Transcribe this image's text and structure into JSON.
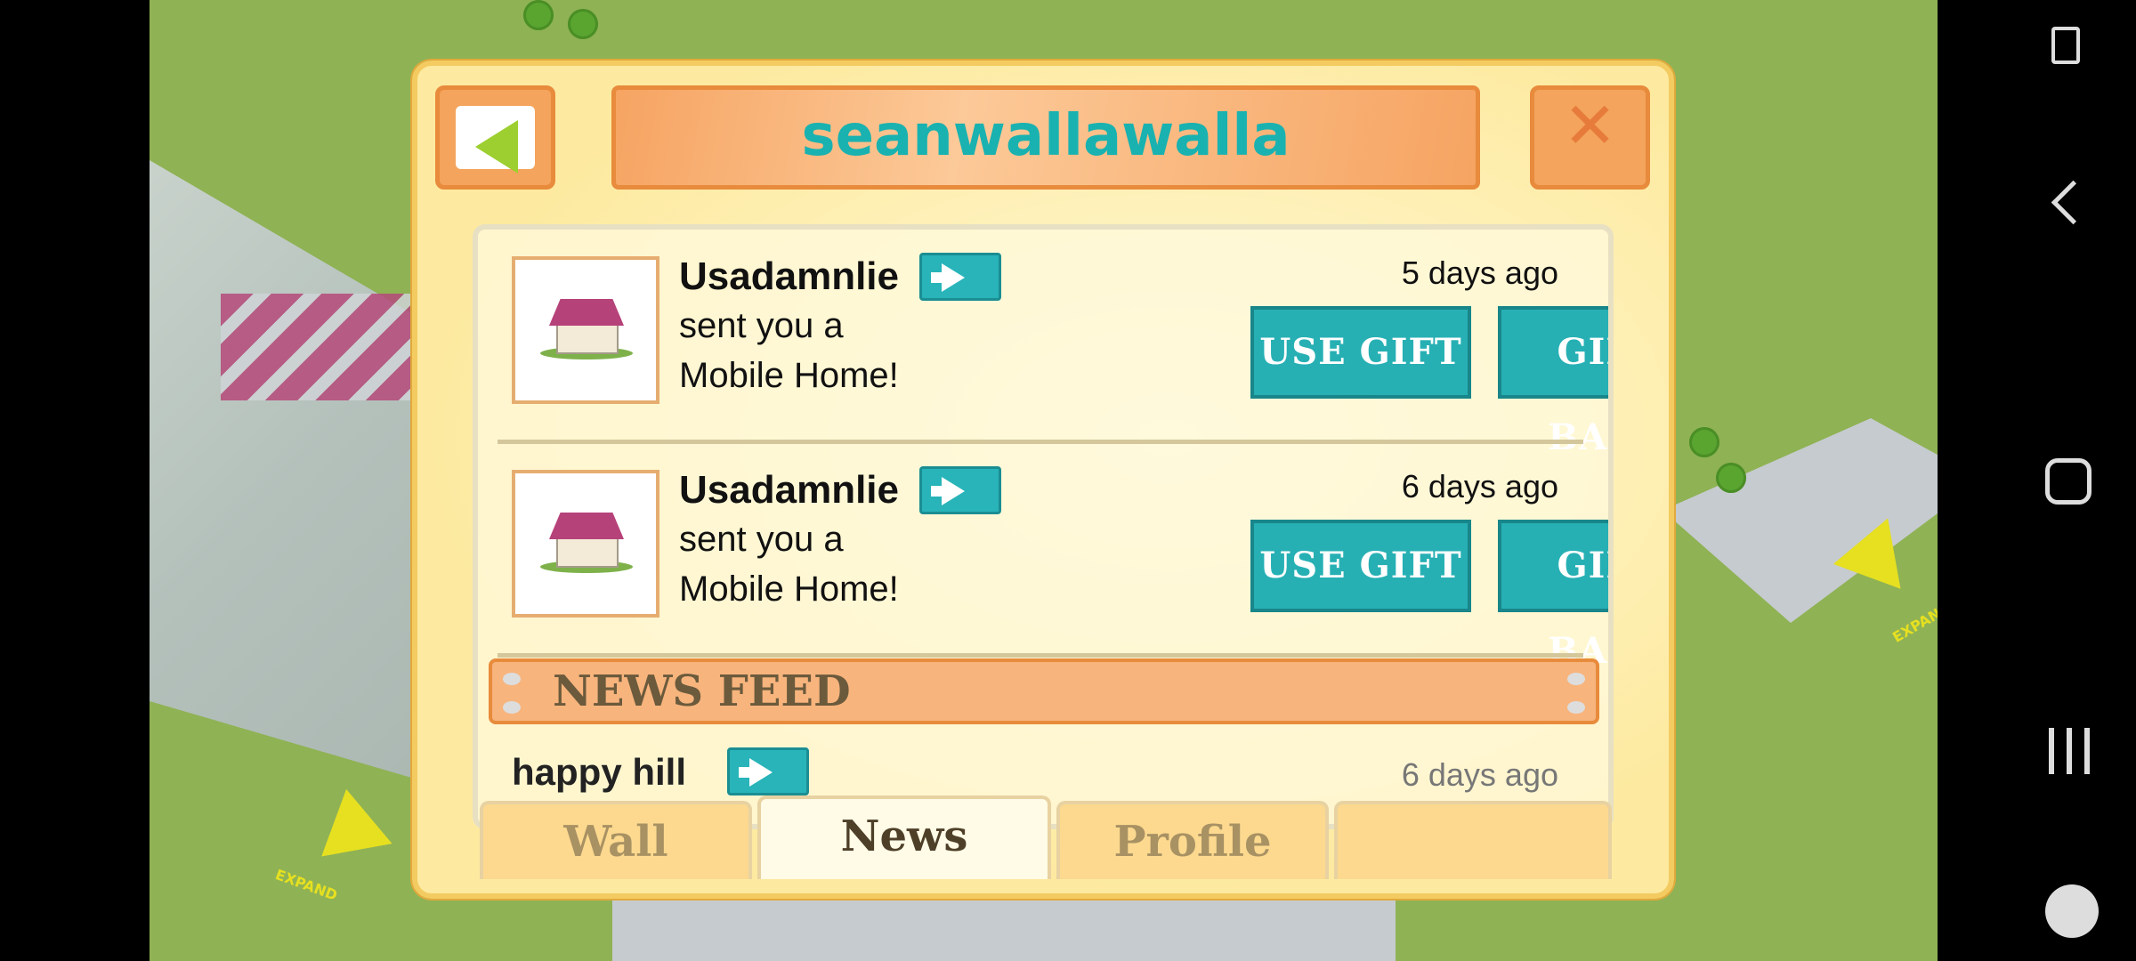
{
  "dialog": {
    "title": "seanwallawalla"
  },
  "gifts": [
    {
      "sender": "Usadamnlie",
      "line1": "sent you a",
      "line2": "Mobile Home!",
      "time": "5 days ago",
      "use_label": "USE GIFT",
      "back_label": "GIFT BACK"
    },
    {
      "sender": "Usadamnlie",
      "line1": "sent you a",
      "line2": "Mobile Home!",
      "time": "6 days ago",
      "use_label": "USE GIFT",
      "back_label": "GIFT BACK"
    }
  ],
  "news_feed": {
    "title": "NEWS FEED",
    "items": [
      {
        "sender": "happy hill",
        "time": "6 days ago"
      }
    ]
  },
  "tabs": [
    {
      "label": "Wall",
      "active": false
    },
    {
      "label": "News",
      "active": true
    },
    {
      "label": "Profile",
      "active": false
    },
    {
      "label": "",
      "active": false
    }
  ],
  "map": {
    "expand_label": "EXPAND"
  },
  "colors": {
    "accent": "#19b2b0",
    "button": "#27b0b4",
    "header_orange": "#f6a462",
    "dialog_bg": "#fdeaa0"
  }
}
